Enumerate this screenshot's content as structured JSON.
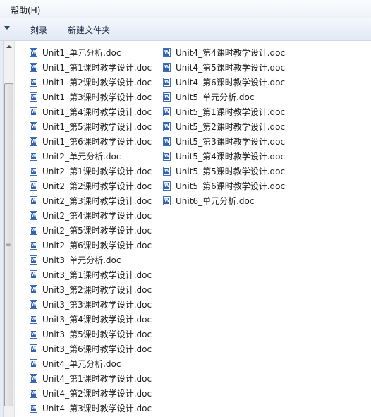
{
  "menu": {
    "help": "帮助(H)"
  },
  "toolbar": {
    "burn": "刻录",
    "new_folder": "新建文件夹"
  },
  "scrollbar": {
    "grip": "≡"
  },
  "files": {
    "column1": [
      "Unit1_单元分析.doc",
      "Unit1_第1课时教学设计.doc",
      "Unit1_第2课时教学设计.doc",
      "Unit1_第3课时教学设计.doc",
      "Unit1_第4课时教学设计.doc",
      "Unit1_第5课时教学设计.doc",
      "Unit1_第6课时教学设计.doc",
      "Unit2_单元分析.doc",
      "Unit2_第1课时教学设计.doc",
      "Unit2_第2课时教学设计.doc",
      "Unit2_第3课时教学设计.doc",
      "Unit2_第4课时教学设计.doc",
      "Unit2_第5课时教学设计.doc",
      "Unit2_第6课时教学设计.doc",
      "Unit3_单元分析.doc",
      "Unit3_第1课时教学设计.doc",
      "Unit3_第2课时教学设计.doc",
      "Unit3_第3课时教学设计.doc",
      "Unit3_第4课时教学设计.doc",
      "Unit3_第5课时教学设计.doc",
      "Unit3_第6课时教学设计.doc",
      "Unit4_单元分析.doc",
      "Unit4_第1课时教学设计.doc",
      "Unit4_第2课时教学设计.doc",
      "Unit4_第3课时教学设计.doc"
    ],
    "column2": [
      "Unit4_第4课时教学设计.doc",
      "Unit4_第5课时教学设计.doc",
      "Unit4_第6课时教学设计.doc",
      "Unit5_单元分析.doc",
      "Unit5_第1课时教学设计.doc",
      "Unit5_第2课时教学设计.doc",
      "Unit5_第3课时教学设计.doc",
      "Unit5_第4课时教学设计.doc",
      "Unit5_第5课时教学设计.doc",
      "Unit5_第6课时教学设计.doc",
      "Unit6_单元分析.doc"
    ]
  }
}
